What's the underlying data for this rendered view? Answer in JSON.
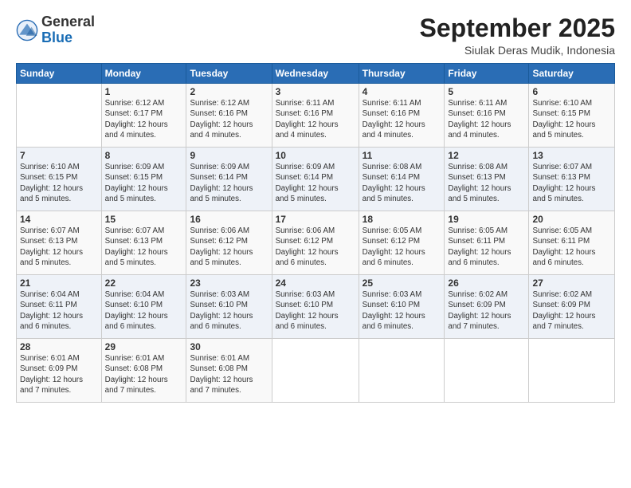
{
  "header": {
    "logo_general": "General",
    "logo_blue": "Blue",
    "month": "September 2025",
    "location": "Siulak Deras Mudik, Indonesia"
  },
  "weekdays": [
    "Sunday",
    "Monday",
    "Tuesday",
    "Wednesday",
    "Thursday",
    "Friday",
    "Saturday"
  ],
  "weeks": [
    [
      null,
      {
        "day": "1",
        "sunrise": "6:12 AM",
        "sunset": "6:17 PM",
        "daylight": "12 hours and 4 minutes."
      },
      {
        "day": "2",
        "sunrise": "6:12 AM",
        "sunset": "6:16 PM",
        "daylight": "12 hours and 4 minutes."
      },
      {
        "day": "3",
        "sunrise": "6:11 AM",
        "sunset": "6:16 PM",
        "daylight": "12 hours and 4 minutes."
      },
      {
        "day": "4",
        "sunrise": "6:11 AM",
        "sunset": "6:16 PM",
        "daylight": "12 hours and 4 minutes."
      },
      {
        "day": "5",
        "sunrise": "6:11 AM",
        "sunset": "6:16 PM",
        "daylight": "12 hours and 4 minutes."
      },
      {
        "day": "6",
        "sunrise": "6:10 AM",
        "sunset": "6:15 PM",
        "daylight": "12 hours and 5 minutes."
      }
    ],
    [
      {
        "day": "7",
        "sunrise": "6:10 AM",
        "sunset": "6:15 PM",
        "daylight": "12 hours and 5 minutes."
      },
      {
        "day": "8",
        "sunrise": "6:09 AM",
        "sunset": "6:15 PM",
        "daylight": "12 hours and 5 minutes."
      },
      {
        "day": "9",
        "sunrise": "6:09 AM",
        "sunset": "6:14 PM",
        "daylight": "12 hours and 5 minutes."
      },
      {
        "day": "10",
        "sunrise": "6:09 AM",
        "sunset": "6:14 PM",
        "daylight": "12 hours and 5 minutes."
      },
      {
        "day": "11",
        "sunrise": "6:08 AM",
        "sunset": "6:14 PM",
        "daylight": "12 hours and 5 minutes."
      },
      {
        "day": "12",
        "sunrise": "6:08 AM",
        "sunset": "6:13 PM",
        "daylight": "12 hours and 5 minutes."
      },
      {
        "day": "13",
        "sunrise": "6:07 AM",
        "sunset": "6:13 PM",
        "daylight": "12 hours and 5 minutes."
      }
    ],
    [
      {
        "day": "14",
        "sunrise": "6:07 AM",
        "sunset": "6:13 PM",
        "daylight": "12 hours and 5 minutes."
      },
      {
        "day": "15",
        "sunrise": "6:07 AM",
        "sunset": "6:13 PM",
        "daylight": "12 hours and 5 minutes."
      },
      {
        "day": "16",
        "sunrise": "6:06 AM",
        "sunset": "6:12 PM",
        "daylight": "12 hours and 5 minutes."
      },
      {
        "day": "17",
        "sunrise": "6:06 AM",
        "sunset": "6:12 PM",
        "daylight": "12 hours and 6 minutes."
      },
      {
        "day": "18",
        "sunrise": "6:05 AM",
        "sunset": "6:12 PM",
        "daylight": "12 hours and 6 minutes."
      },
      {
        "day": "19",
        "sunrise": "6:05 AM",
        "sunset": "6:11 PM",
        "daylight": "12 hours and 6 minutes."
      },
      {
        "day": "20",
        "sunrise": "6:05 AM",
        "sunset": "6:11 PM",
        "daylight": "12 hours and 6 minutes."
      }
    ],
    [
      {
        "day": "21",
        "sunrise": "6:04 AM",
        "sunset": "6:11 PM",
        "daylight": "12 hours and 6 minutes."
      },
      {
        "day": "22",
        "sunrise": "6:04 AM",
        "sunset": "6:10 PM",
        "daylight": "12 hours and 6 minutes."
      },
      {
        "day": "23",
        "sunrise": "6:03 AM",
        "sunset": "6:10 PM",
        "daylight": "12 hours and 6 minutes."
      },
      {
        "day": "24",
        "sunrise": "6:03 AM",
        "sunset": "6:10 PM",
        "daylight": "12 hours and 6 minutes."
      },
      {
        "day": "25",
        "sunrise": "6:03 AM",
        "sunset": "6:10 PM",
        "daylight": "12 hours and 6 minutes."
      },
      {
        "day": "26",
        "sunrise": "6:02 AM",
        "sunset": "6:09 PM",
        "daylight": "12 hours and 7 minutes."
      },
      {
        "day": "27",
        "sunrise": "6:02 AM",
        "sunset": "6:09 PM",
        "daylight": "12 hours and 7 minutes."
      }
    ],
    [
      {
        "day": "28",
        "sunrise": "6:01 AM",
        "sunset": "6:09 PM",
        "daylight": "12 hours and 7 minutes."
      },
      {
        "day": "29",
        "sunrise": "6:01 AM",
        "sunset": "6:08 PM",
        "daylight": "12 hours and 7 minutes."
      },
      {
        "day": "30",
        "sunrise": "6:01 AM",
        "sunset": "6:08 PM",
        "daylight": "12 hours and 7 minutes."
      },
      null,
      null,
      null,
      null
    ]
  ]
}
